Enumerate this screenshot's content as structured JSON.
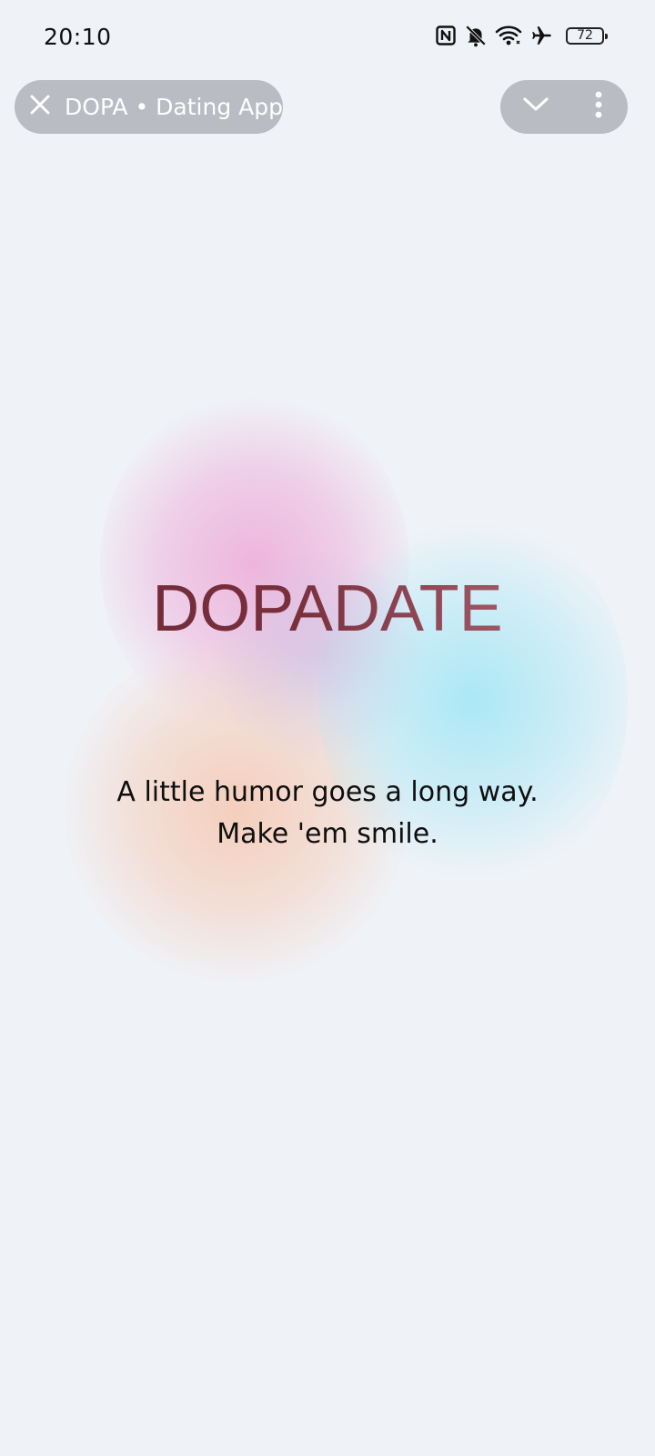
{
  "status_bar": {
    "time": "20:10",
    "battery": "72",
    "icons": [
      "nfc-icon",
      "bell-off-icon",
      "wifi-icon",
      "airplane-icon",
      "battery-icon"
    ]
  },
  "top_bar": {
    "title": "DOPA • Dating App",
    "left_icon": "close-icon",
    "right_icons": [
      "chevron-down-icon",
      "more-vert-icon"
    ]
  },
  "splash": {
    "brand": "DOPADATE",
    "tagline_line1": "A little humor goes a long way.",
    "tagline_line2": "Make 'em smile."
  },
  "colors": {
    "background": "#eff2f7",
    "pill": "#b9bcc2",
    "brand_dark": "#6a2a35",
    "brand_light": "#b87582",
    "blob_pink": "#eeaad7",
    "blob_blue": "#a0e6f5",
    "blob_peach": "#f6c8b2"
  }
}
